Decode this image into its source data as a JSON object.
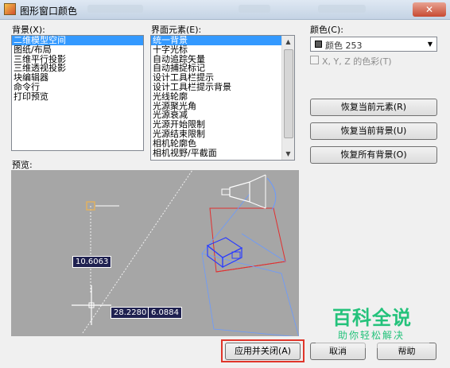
{
  "window": {
    "title": "图形窗口颜色",
    "close_glyph": "✕"
  },
  "background": {
    "label": "背景(X):",
    "items": [
      "二维模型空间",
      "图纸/布局",
      "三维平行投影",
      "三维透视投影",
      "块编辑器",
      "命令行",
      "打印预览"
    ],
    "selected_index": 0
  },
  "elements": {
    "label": "界面元素(E):",
    "items": [
      "统一背景",
      "十字光标",
      "自动追踪矢量",
      "自动捕捉标记",
      "设计工具栏提示",
      "设计工具栏提示背景",
      "光线轮廓",
      "光源聚光角",
      "光源衰减",
      "光源开始限制",
      "光源结束限制",
      "相机轮廓色",
      "相机视野/平截面"
    ],
    "selected_index": 0
  },
  "color": {
    "label": "颜色(C):",
    "value": "颜色 253",
    "swatch": "#5a5a5a",
    "tint_label": "X, Y, Z 的色彩(T)"
  },
  "buttons": {
    "restore_element": "恢复当前元素(R)",
    "restore_background": "恢复当前背景(U)",
    "restore_all": "恢复所有背景(O)",
    "apply_close": "应用并关闭(A)",
    "cancel": "取消",
    "help": "帮助"
  },
  "preview": {
    "label": "预览:",
    "coord1": "10.6063",
    "coord2": "28.2280",
    "coord3": "6.0884",
    "bg_color": "#a6a6a6"
  },
  "watermark": {
    "title": "百科全说",
    "subtitle": "助你轻松解决"
  }
}
